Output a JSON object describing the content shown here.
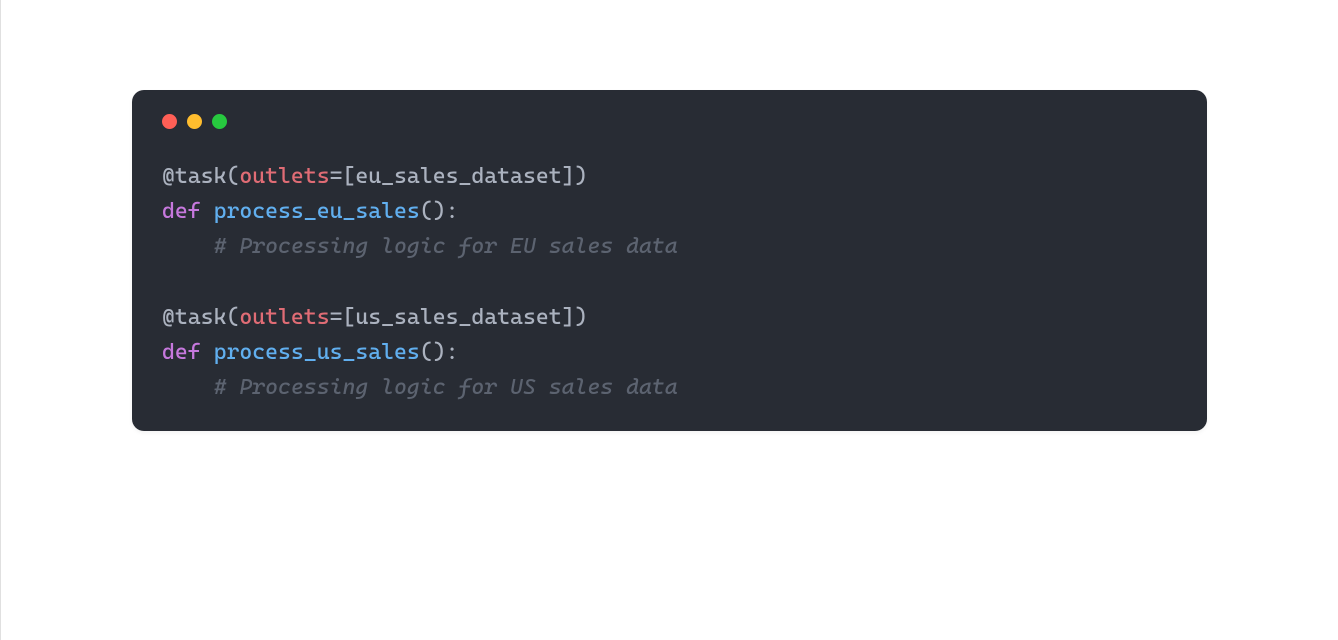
{
  "colors": {
    "window_bg": "#282c34",
    "traffic_red": "#ff5f56",
    "traffic_yellow": "#ffbd2e",
    "traffic_green": "#27c93f",
    "token_default": "#abb2bf",
    "token_keyword": "#c678dd",
    "token_param": "#e06c75",
    "token_func": "#61afef",
    "token_comment": "#5c6370"
  },
  "code": {
    "lines": [
      {
        "indent": 0,
        "tokens": [
          {
            "t": "@task",
            "c": "tok-decor"
          },
          {
            "t": "(",
            "c": "tok-decor"
          },
          {
            "t": "outlets",
            "c": "tok-param"
          },
          {
            "t": "=[",
            "c": "tok-decor"
          },
          {
            "t": "eu_sales_dataset",
            "c": "tok-var"
          },
          {
            "t": "])",
            "c": "tok-decor"
          }
        ]
      },
      {
        "indent": 0,
        "tokens": [
          {
            "t": "def ",
            "c": "tok-keyword"
          },
          {
            "t": "process_eu_sales",
            "c": "tok-func"
          },
          {
            "t": "():",
            "c": "tok-decor"
          }
        ]
      },
      {
        "indent": 1,
        "tokens": [
          {
            "t": "# Processing logic for EU sales data",
            "c": "tok-comment"
          }
        ]
      },
      {
        "indent": 0,
        "tokens": []
      },
      {
        "indent": 0,
        "tokens": [
          {
            "t": "@task",
            "c": "tok-decor"
          },
          {
            "t": "(",
            "c": "tok-decor"
          },
          {
            "t": "outlets",
            "c": "tok-param"
          },
          {
            "t": "=[",
            "c": "tok-decor"
          },
          {
            "t": "us_sales_dataset",
            "c": "tok-var"
          },
          {
            "t": "])",
            "c": "tok-decor"
          }
        ]
      },
      {
        "indent": 0,
        "tokens": [
          {
            "t": "def ",
            "c": "tok-keyword"
          },
          {
            "t": "process_us_sales",
            "c": "tok-func"
          },
          {
            "t": "():",
            "c": "tok-decor"
          }
        ]
      },
      {
        "indent": 1,
        "tokens": [
          {
            "t": "# Processing logic for US sales data",
            "c": "tok-comment"
          }
        ]
      }
    ],
    "indent_unit": "    "
  }
}
